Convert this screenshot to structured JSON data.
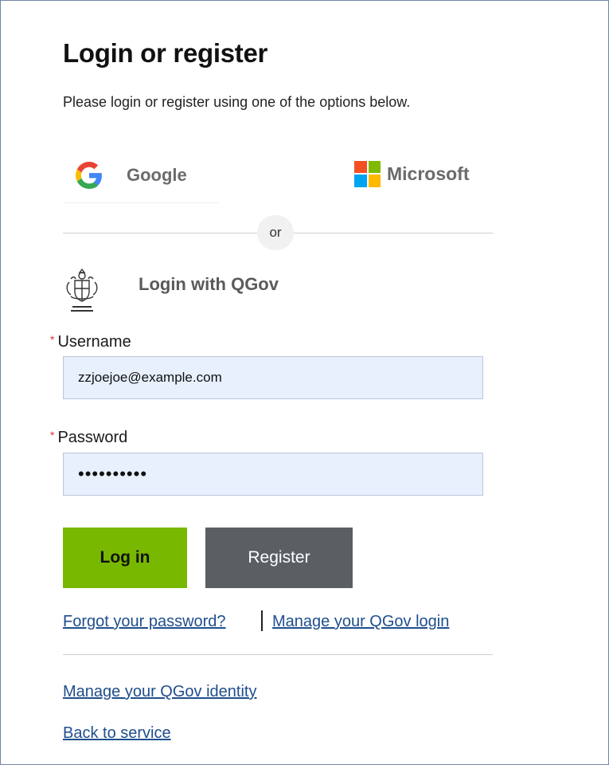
{
  "page": {
    "title": "Login or register",
    "subtitle": "Please login or register using one of the options below."
  },
  "providers": {
    "google": {
      "label": "Google",
      "icon": "google-g-icon"
    },
    "microsoft": {
      "label": "Microsoft",
      "icon": "microsoft-logo-icon",
      "colors": [
        "#f25022",
        "#7fba00",
        "#00a4ef",
        "#ffb900"
      ]
    },
    "divider_text": "or",
    "qgov": {
      "label": "Login with QGov",
      "icon": "queensland-government-crest-icon"
    }
  },
  "form": {
    "username": {
      "required_mark": "*",
      "label": "Username",
      "value": "zzjoejoe@example.com"
    },
    "password": {
      "required_mark": "*",
      "label": "Password",
      "value": "••••••••••"
    },
    "login_button": "Log in",
    "register_button": "Register"
  },
  "links": {
    "forgot_password": "Forgot your password?",
    "manage_login": "Manage your QGov login",
    "manage_identity": "Manage your QGov identity",
    "back_to_service": "Back to service"
  },
  "colors": {
    "login_button": "#78b800",
    "register_button": "#5a5f63",
    "link": "#1f4e8c",
    "required": "#d9342b",
    "input_background": "#e8f0fe"
  }
}
